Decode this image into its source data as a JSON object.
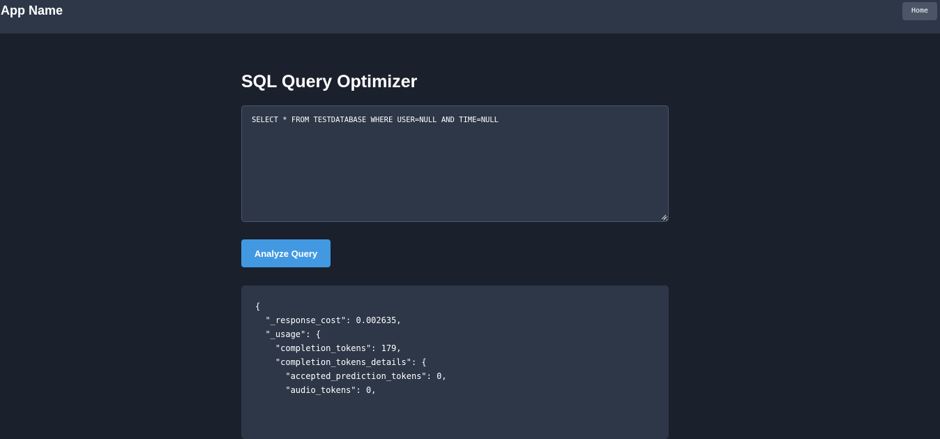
{
  "header": {
    "app_name": "App Name",
    "home_label": "Home"
  },
  "main": {
    "title": "SQL Query Optimizer",
    "query_value": "SELECT * FROM TESTDATABASE WHERE USER=NULL AND TIME=NULL",
    "analyze_label": "Analyze Query",
    "result_text": "{\n  \"_response_cost\": 0.002635,\n  \"_usage\": {\n    \"completion_tokens\": 179,\n    \"completion_tokens_details\": {\n      \"accepted_prediction_tokens\": 0,\n      \"audio_tokens\": 0,"
  },
  "colors": {
    "background": "#1a202c",
    "panel": "#2d3748",
    "accent": "#4299e1",
    "home_button": "#4a5568"
  },
  "icons": {
    "resize_handle": "resize-grip-icon"
  }
}
